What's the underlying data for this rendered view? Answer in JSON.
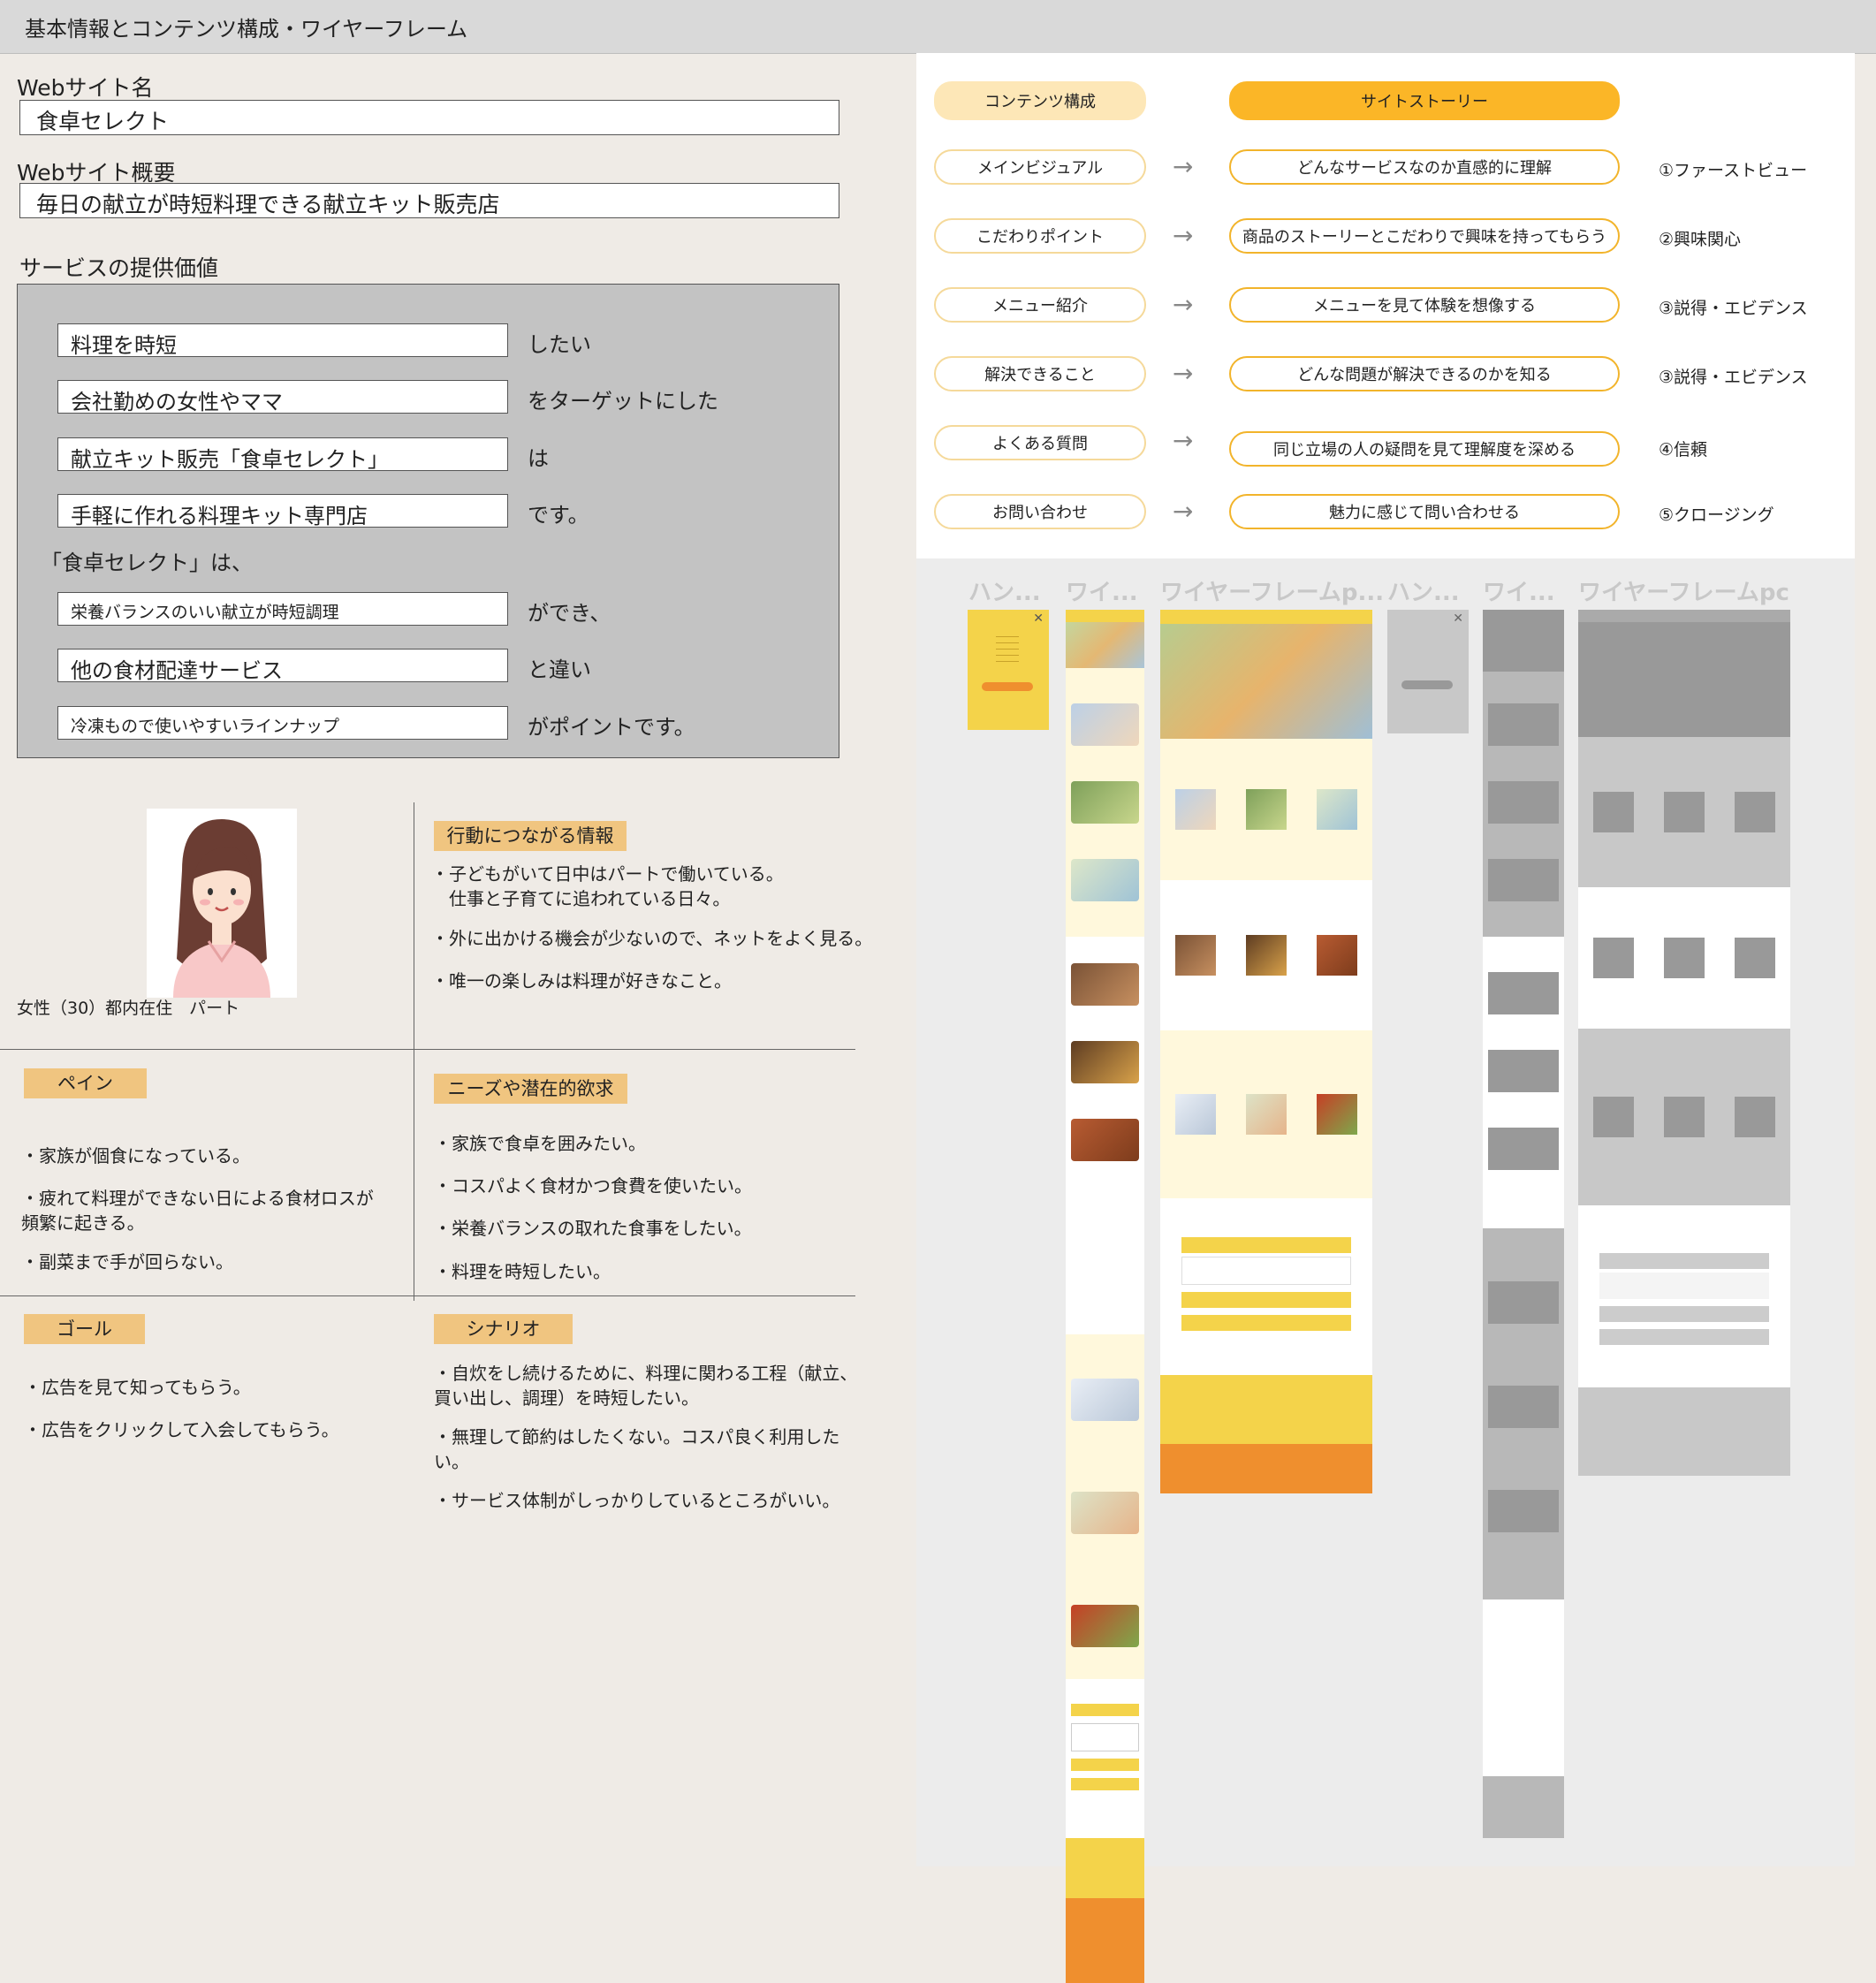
{
  "header": {
    "title": "基本情報とコンテンツ構成・ワイヤーフレーム"
  },
  "site": {
    "name_label": "Webサイト名",
    "name": "食卓セレクト",
    "summary_label": "Webサイト概要",
    "summary": "毎日の献立が時短料理できる献立キット販売店"
  },
  "value": {
    "label": "サービスの提供価値",
    "rows": [
      {
        "box": "料理を時短",
        "suffix": "したい"
      },
      {
        "box": "会社勤めの女性やママ",
        "suffix": "をターゲットにした"
      },
      {
        "box": "献立キット販売「食卓セレクト」",
        "suffix": "は"
      },
      {
        "box": "手軽に作れる料理キット専門店",
        "suffix": "です。"
      },
      {
        "box": "栄養バランスのいい献立が時短調理",
        "suffix": "ができ、"
      },
      {
        "box": "他の食材配達サービス",
        "suffix": "と違い"
      },
      {
        "box": "冷凍もので使いやすいラインナップ",
        "suffix": "がポイントです。"
      }
    ],
    "mid_text": "「食卓セレクト」は、"
  },
  "persona": {
    "caption": "女性（30）都内在住　パート",
    "info_tag": "行動につながる情報",
    "info_points": [
      "・子どもがいて日中はパートで働いている。\n　仕事と子育てに追われている日々。",
      "・外に出かける機会が少ないので、ネットをよく見る。",
      "・唯一の楽しみは料理が好きなこと。"
    ],
    "pain_tag": "ペイン",
    "pain_points": [
      "・家族が個食になっている。",
      "・疲れて料理ができない日による食材ロスが\n頻繁に起きる。",
      "・副菜まで手が回らない。"
    ],
    "needs_tag": "ニーズや潜在的欲求",
    "needs_points": [
      "・家族で食卓を囲みたい。",
      "・コスパよく食材かつ食費を使いたい。",
      "・栄養バランスの取れた食事をしたい。",
      "・料理を時短したい。"
    ],
    "goal_tag": "ゴール",
    "goal_points": [
      "・広告を見て知ってもらう。",
      "・広告をクリックして入会してもらう。"
    ],
    "scenario_tag": "シナリオ",
    "scenario_points": [
      "・自炊をし続けるために、料理に関わる工程（献立、\n買い出し、調理）を時短したい。",
      "・無理して節約はしたくない。コスパ良く利用した\nい。",
      "・サービス体制がしっかりしているところがいい。"
    ]
  },
  "structure": {
    "content_header": "コンテンツ構成",
    "story_header": "サイトストーリー",
    "rows": [
      {
        "content": "メインビジュアル",
        "story": "どんなサービスなのか直感的に理解",
        "stage": "①ファーストビュー"
      },
      {
        "content": "こだわりポイント",
        "story": "商品のストーリーとこだわりで興味を持ってもらう",
        "stage": "②興味関心"
      },
      {
        "content": "メニュー紹介",
        "story": "メニューを見て体験を想像する",
        "stage": "③説得・エビデンス"
      },
      {
        "content": "解決できること",
        "story": "どんな問題が解決できるのかを知る",
        "stage": "③説得・エビデンス"
      },
      {
        "content": "よくある質問",
        "story": "同じ立場の人の疑問を見て理解度を深める",
        "stage": "④信頼"
      },
      {
        "content": "お問い合わせ",
        "story": "魅力に感じて問い合わせる",
        "stage": "⑤クロージング"
      }
    ],
    "arrow": "→"
  },
  "wireframes": {
    "titles": [
      "ハン...",
      "ワイ...",
      "ワイヤーフレームp...",
      "ハン...",
      "ワイ...",
      "ワイヤーフレームpc"
    ],
    "colors": {
      "yellow": "#f4d34a",
      "orange": "#ef8f2e",
      "cream": "#fff8dc",
      "gray": "#b8b8b8"
    }
  }
}
